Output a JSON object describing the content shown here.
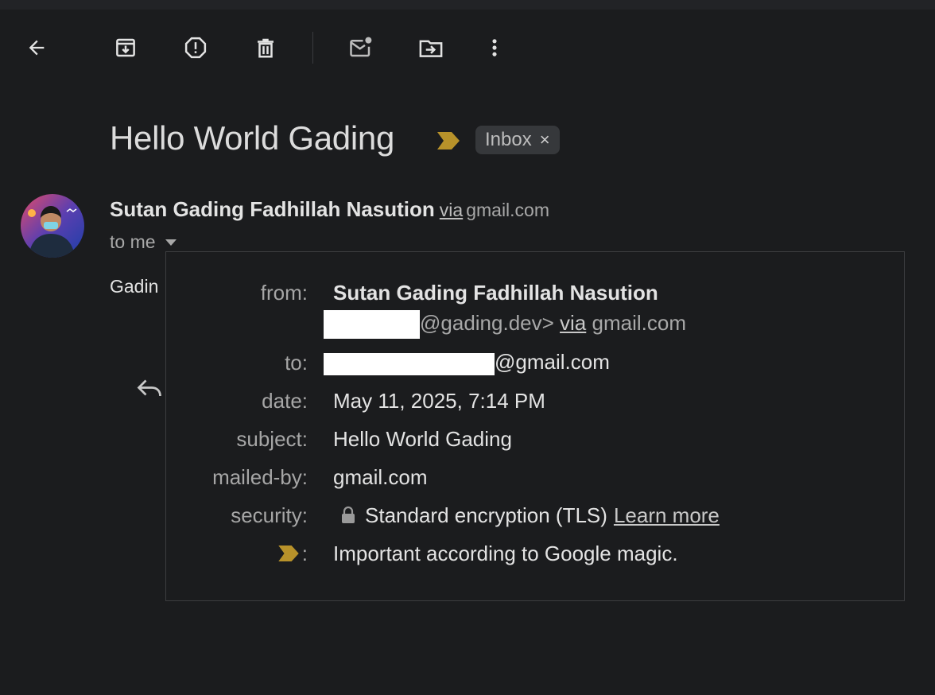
{
  "toolbar": {
    "back_icon": "arrow-left-icon",
    "archive_icon": "archive-icon",
    "spam_icon": "report-spam-icon",
    "delete_icon": "trash-icon",
    "unread_icon": "mark-unread-icon",
    "move_icon": "move-to-folder-icon",
    "more_icon": "more-vertical-icon"
  },
  "message": {
    "subject": "Hello World Gading",
    "importance_color": "#b8922a",
    "label": "Inbox",
    "label_remove": "×",
    "sender_name": "Sutan Gading Fadhillah Nasution",
    "via": "via",
    "via_domain": "gmail.com",
    "to_me": "to me",
    "snippet": "Gadin"
  },
  "details": {
    "from_label": "from:",
    "from_name": "Sutan Gading Fadhillah Nasution",
    "from_email_suffix": "@gading.dev>",
    "from_via": "via",
    "from_via_domain": "gmail.com",
    "to_label": "to:",
    "to_email_suffix": "@gmail.com",
    "date_label": "date:",
    "date_value": "May 11, 2025, 7:14 PM",
    "subject_label": "subject:",
    "subject_value": "Hello World Gading",
    "mailed_by_label": "mailed-by:",
    "mailed_by_value": "gmail.com",
    "security_label": "security:",
    "security_value": "Standard encryption (TLS)",
    "learn_more": "Learn more",
    "importance_label": ":",
    "importance_value": "Important according to Google magic."
  }
}
